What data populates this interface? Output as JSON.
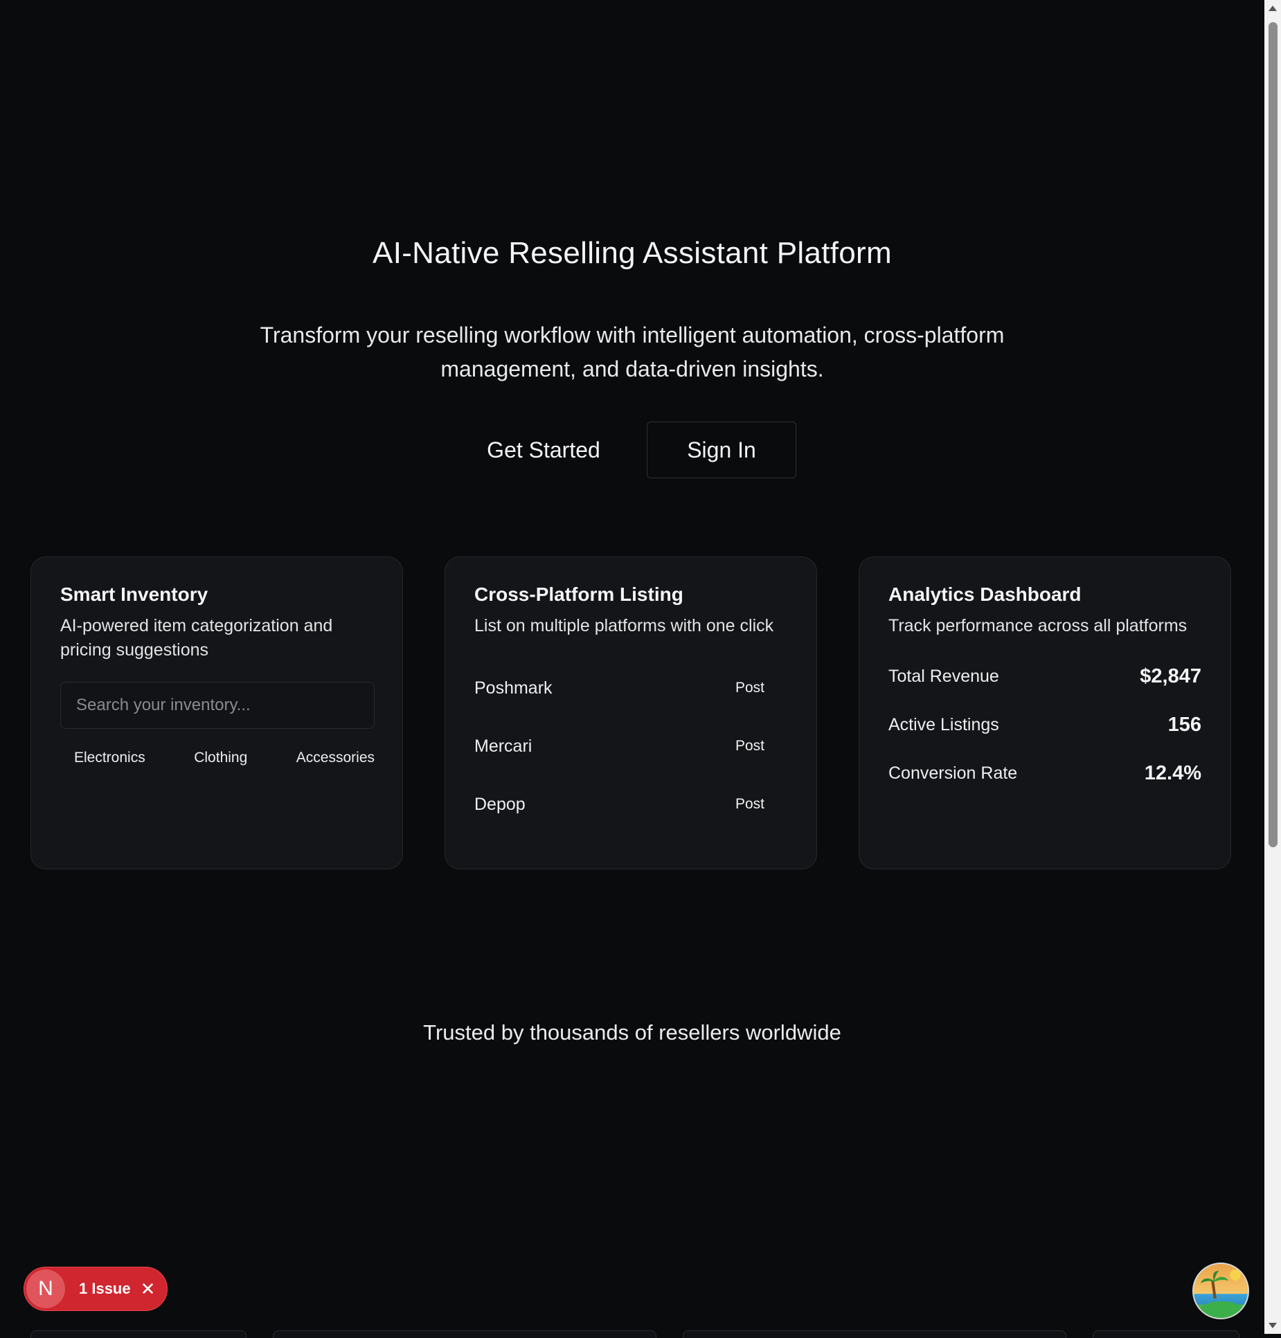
{
  "hero": {
    "title": "AI-Native Reselling Assistant Platform",
    "subtitle": "Transform your reselling workflow with intelligent automation, cross-platform management, and data-driven insights.",
    "get_started_label": "Get Started",
    "sign_in_label": "Sign In"
  },
  "cards": {
    "inventory": {
      "title": "Smart Inventory",
      "description": "AI-powered item categorization and pricing suggestions",
      "search_placeholder": "Search your inventory...",
      "search_value": "",
      "categories": [
        "Electronics",
        "Clothing",
        "Accessories"
      ]
    },
    "listing": {
      "title": "Cross-Platform Listing",
      "description": "List on multiple platforms with one click",
      "platforms": [
        {
          "name": "Poshmark",
          "action": "Post"
        },
        {
          "name": "Mercari",
          "action": "Post"
        },
        {
          "name": "Depop",
          "action": "Post"
        }
      ]
    },
    "analytics": {
      "title": "Analytics Dashboard",
      "description": "Track performance across all platforms",
      "stats": [
        {
          "label": "Total Revenue",
          "value": "$2,847"
        },
        {
          "label": "Active Listings",
          "value": "156"
        },
        {
          "label": "Conversion Rate",
          "value": "12.4%"
        }
      ]
    }
  },
  "trusted_text": "Trusted by thousands of resellers worldwide",
  "issue_badge": {
    "logo_letter": "N",
    "label": "1 Issue",
    "close_glyph": "✕",
    "color": "#d0262f"
  },
  "avatar": {
    "icon": "beach-avatar-icon"
  },
  "colors": {
    "background": "#0a0b0d",
    "card": "#141518",
    "card_border": "#26272b"
  }
}
